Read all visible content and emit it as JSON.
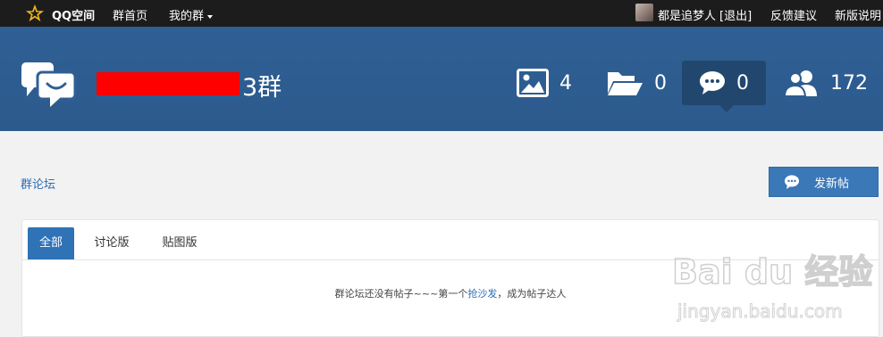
{
  "topbar": {
    "brand": "QQ空间",
    "nav_home": "群首页",
    "nav_mygroup": "我的群",
    "username": "都是追梦人",
    "logout": "[退出]",
    "feedback": "反馈建议",
    "new_version": "新版说明"
  },
  "header": {
    "group_name_suffix": "3群",
    "stats": {
      "photos": "4",
      "files": "0",
      "forum": "0",
      "members": "172"
    }
  },
  "breadcrumb": "群论坛",
  "new_post_label": "发新帖",
  "tabs": [
    "全部",
    "讨论版",
    "贴图版"
  ],
  "empty": {
    "before": "群论坛还没有帖子~~~第一个",
    "link": "抢沙发",
    "after": "，成为帖子达人"
  },
  "watermark": {
    "brand": "Bai du 经验",
    "url": "jingyan.baidu.com"
  },
  "colors": {
    "header_bg": "#2f5f94",
    "accent": "#2f72b6",
    "redaction": "#ff0000"
  }
}
